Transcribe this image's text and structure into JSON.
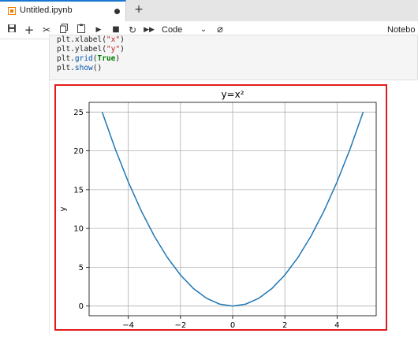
{
  "tab": {
    "title": "Untitled.ipynb"
  },
  "toolbar": {
    "cell_type": "Code",
    "kernel_label": "Notebo",
    "icons": [
      "save-icon",
      "add-cell-icon",
      "cut-icon",
      "copy-icon",
      "paste-icon",
      "run-icon",
      "stop-icon",
      "restart-icon",
      "fast-forward-icon",
      "chevron-down-icon",
      "refresh-circle-icon"
    ]
  },
  "code": {
    "line1_prefix": "plt.xlabel(",
    "line1_arg": "\"x\"",
    "line1_suffix": ")",
    "line2_prefix": "plt.ylabel(",
    "line2_arg": "\"y\"",
    "line2_suffix": ")",
    "line3_prefix": "plt.",
    "line3_fn": "grid",
    "line3_open": "(",
    "line3_arg": "True",
    "line3_suffix": ")",
    "line4_prefix": "plt.",
    "line4_fn": "show",
    "line4_suffix": "()"
  },
  "chart_data": {
    "type": "line",
    "title": "y=x²",
    "xlabel": "",
    "ylabel": "y",
    "xlim": [
      -5.5,
      5.5
    ],
    "ylim": [
      -1.25,
      26.25
    ],
    "xticks": [
      -4,
      -2,
      0,
      2,
      4
    ],
    "xtick_labels": [
      "−4",
      "−2",
      "0",
      "2",
      "4"
    ],
    "yticks": [
      0,
      5,
      10,
      15,
      20,
      25
    ],
    "ytick_labels": [
      "0",
      "5",
      "10",
      "15",
      "20",
      "25"
    ],
    "grid": true,
    "series": [
      {
        "color": "#1f77b4",
        "x": [
          -5,
          -4.5,
          -4,
          -3.5,
          -3,
          -2.5,
          -2,
          -1.5,
          -1,
          -0.5,
          0,
          0.5,
          1,
          1.5,
          2,
          2.5,
          3,
          3.5,
          4,
          4.5,
          5
        ],
        "y": [
          25,
          20.25,
          16,
          12.25,
          9,
          6.25,
          4,
          2.25,
          1,
          0.25,
          0,
          0.25,
          1,
          2.25,
          4,
          6.25,
          9,
          12.25,
          16,
          20.25,
          25
        ]
      }
    ]
  }
}
